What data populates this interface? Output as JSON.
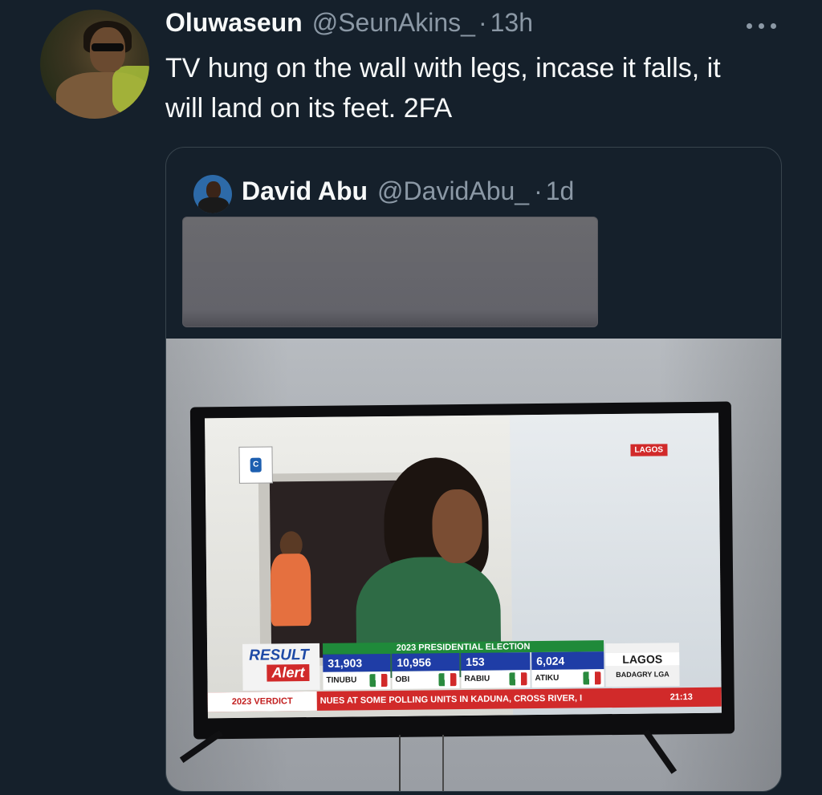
{
  "tweet": {
    "author_name": "Oluwaseun",
    "author_handle": "@SeunAkins_",
    "separator": "·",
    "time": "13h",
    "text": "TV hung on the wall with legs, incase it falls, it will land on its feet. 2FA"
  },
  "quoted_tweet": {
    "author_name": "David Abu",
    "author_handle": "@DavidAbu_",
    "separator": "·",
    "time": "1d"
  },
  "tv_screen": {
    "channel_logo_text": "CHANNELS",
    "location_badge": "LAGOS",
    "result_label": "RESULT",
    "alert_label": "Alert",
    "election_title": "2023 PRESIDENTIAL ELECTION",
    "candidates": [
      {
        "votes": "31,903",
        "name": "TINUBU"
      },
      {
        "votes": "10,956",
        "name": "OBI"
      },
      {
        "votes": "153",
        "name": "RABIU"
      },
      {
        "votes": "6,024",
        "name": "ATIKU"
      }
    ],
    "region": "LAGOS",
    "lga": "BADAGRY LGA",
    "verdict_label": "2023 VERDICT",
    "ticker": "NUES AT SOME POLLING UNITS IN KADUNA, CROSS RIVER, I",
    "clock": "21:13"
  },
  "icons": {
    "more": "more-horizontal-icon"
  }
}
